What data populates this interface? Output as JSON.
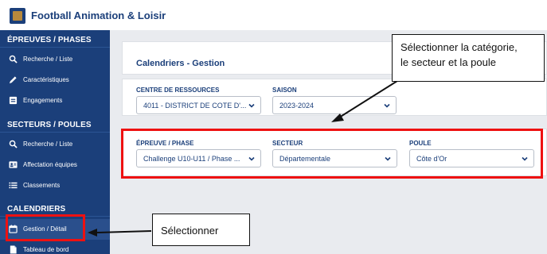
{
  "app": {
    "title": "Football Animation & Loisir"
  },
  "sidebar": {
    "sections": [
      {
        "title": "ÉPREUVES / PHASES",
        "items": [
          {
            "label": "Recherche / Liste",
            "icon": "search-icon"
          },
          {
            "label": "Caractéristiques",
            "icon": "pencil-icon"
          },
          {
            "label": "Engagements",
            "icon": "id-card-icon"
          }
        ]
      },
      {
        "title": "SECTEURS / POULES",
        "items": [
          {
            "label": "Recherche / Liste",
            "icon": "search-icon"
          },
          {
            "label": "Affectation équipes",
            "icon": "contact-card-icon"
          },
          {
            "label": "Classements",
            "icon": "list-icon"
          }
        ]
      },
      {
        "title": "CALENDRIERS",
        "items": [
          {
            "label": "Gestion / Détail",
            "icon": "calendar-icon"
          },
          {
            "label": "Tableau de bord",
            "icon": "document-icon"
          }
        ]
      }
    ]
  },
  "main": {
    "title": "Calendriers - Gestion",
    "filters_top": {
      "centre": {
        "label": "CENTRE DE RESSOURCES",
        "value": "4011 - DISTRICT DE COTE D'..."
      },
      "saison": {
        "label": "SAISON",
        "value": "2023-2024"
      }
    },
    "filters_bottom": {
      "epreuve": {
        "label": "ÉPREUVE / PHASE",
        "value": "Challenge U10-U11 / Phase ..."
      },
      "secteur": {
        "label": "SECTEUR",
        "value": "Départementale"
      },
      "poule": {
        "label": "POULE",
        "value": "Côte d'Or"
      }
    }
  },
  "annotations": {
    "callout_top": {
      "line1": "Sélectionner la catégorie,",
      "line2": "le secteur et la poule"
    },
    "callout_bottom": {
      "text": "Sélectionner"
    },
    "highlight_color": "#e11111"
  },
  "colors": {
    "brand": "#1b3f7a",
    "accent": "#b8893c",
    "background": "#e9ebef"
  }
}
